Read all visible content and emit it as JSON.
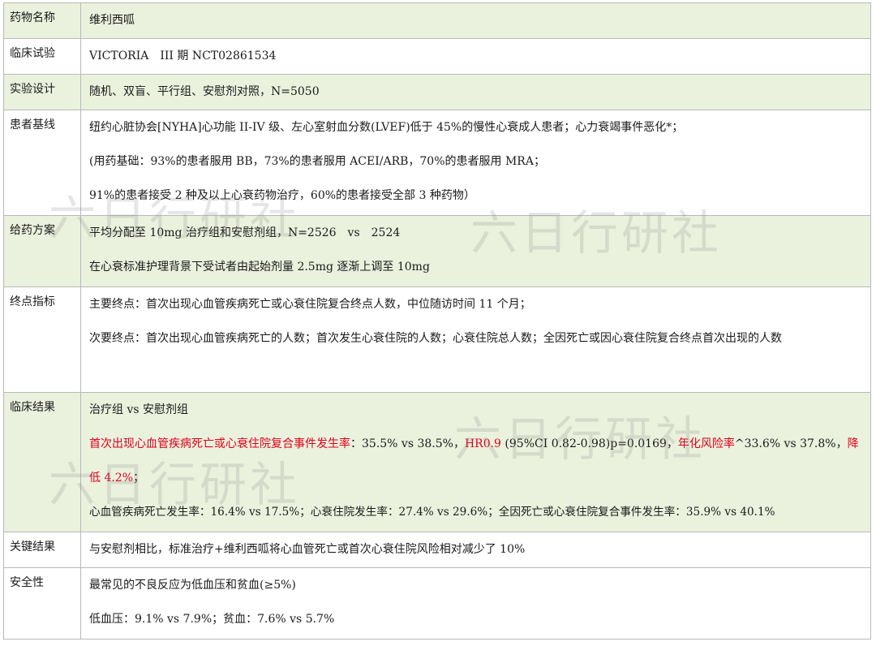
{
  "rows": [
    {
      "label": "药物名称",
      "lines": [
        "维利西呱"
      ]
    },
    {
      "label": "临床试验",
      "lines": [
        "VICTORIA　III 期  NCT02861534"
      ]
    },
    {
      "label": "实验设计",
      "lines": [
        "随机、双盲、平行组、安慰剂对照，N=5050"
      ]
    },
    {
      "label": "患者基线",
      "lines": [
        "纽约心脏协会[NYHA]心功能 II-IV 级、左心室射血分数(LVEF)低于 45%的慢性心衰成人患者；心力衰竭事件恶化*；",
        "(用药基础：93%的患者服用 BB，73%的患者服用 ACEI/ARB，70%的患者服用 MRA；",
        "91%的患者接受 2 种及以上心衰药物治疗，60%的患者接受全部 3 种药物）"
      ]
    },
    {
      "label": "给药方案",
      "lines": [
        "平均分配至 10mg 治疗组和安慰剂组，N=2526　vs　2524",
        "在心衰标准护理背景下受试者由起始剂量 2.5mg 逐渐上调至 10mg"
      ]
    },
    {
      "label": "终点指标",
      "lines": [
        "主要终点：首次出现心血管疾病死亡或心衰住院复合终点人数，中位随访时间 11 个月；",
        "次要终点：首次出现心血管疾病死亡的人数；首次发生心衰住院的人数；心衰住院总人数；全因死亡或因心衰住院复合终点首次出现的人数"
      ]
    },
    {
      "label": "临床结果",
      "line1": "治疗组  vs  安慰剂组",
      "red1": "首次出现心血管疾病死亡或心衰住院复合事件发生率",
      "text1": "：35.5% vs 38.5%，",
      "red2": "HR0.9",
      "text2": " (95%CI 0.82-0.98)p=0.0169，",
      "red3": "年化风险率",
      "text3": "^33.6% vs 37.8%，",
      "red4": "降低 4.2%",
      "text4": "；",
      "line_last": "心血管疾病死亡发生率：16.4% vs 17.5%；心衰住院发生率：27.4% vs 29.6%；全因死亡或心衰住院复合事件发生率：35.9% vs 40.1%"
    },
    {
      "label": "关键结果",
      "lines": [
        "与安慰剂相比，标准治疗+维利西呱将心血管死亡或首次心衰住院风险相对减少了 10%"
      ]
    },
    {
      "label": "安全性",
      "lines": [
        "最常见的不良反应为低血压和贫血(≥5%)",
        "低血压：9.1% vs 7.9%；贫血：7.6% vs 5.7%"
      ]
    }
  ],
  "watermarks": [
    "六日行研社",
    "六日行研社",
    "六日行研社",
    "六日行研社"
  ],
  "colors": {
    "shade": "#eaf1dd",
    "border": "#b9b9b9",
    "highlight": "#e0001b"
  }
}
